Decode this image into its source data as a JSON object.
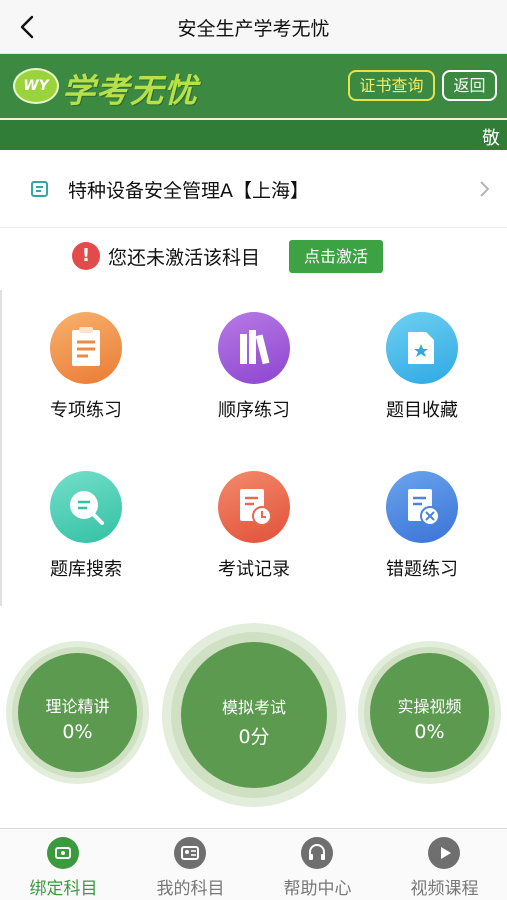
{
  "nav": {
    "title": "安全生产学考无忧"
  },
  "brand": {
    "logo_badge": "WY",
    "logo_text": "学考无忧",
    "cert_button": "证书查询",
    "back_button": "返回",
    "ticker_text": "敬",
    "color": "#3c8a41"
  },
  "subject": {
    "name": "特种设备安全管理A【上海】"
  },
  "notice": {
    "icon": "!",
    "text": "您还未激活该科目",
    "activate_button": "点击激活"
  },
  "features": [
    {
      "label": "专项练习",
      "icon": "clipboard-icon"
    },
    {
      "label": "顺序练习",
      "icon": "books-icon"
    },
    {
      "label": "题目收藏",
      "icon": "star-folder-icon"
    },
    {
      "label": "题库搜索",
      "icon": "search-bubble-icon"
    },
    {
      "label": "考试记录",
      "icon": "clock-doc-icon"
    },
    {
      "label": "错题练习",
      "icon": "error-doc-icon"
    }
  ],
  "progress": [
    {
      "title": "理论精讲",
      "value": "0%"
    },
    {
      "title": "模拟考试",
      "value": "0分"
    },
    {
      "title": "实操视频",
      "value": "0%"
    }
  ],
  "tabs": [
    {
      "label": "绑定科目",
      "icon": "bind-icon",
      "active": true
    },
    {
      "label": "我的科目",
      "icon": "profile-card-icon",
      "active": false
    },
    {
      "label": "帮助中心",
      "icon": "help-headset-icon",
      "active": false
    },
    {
      "label": "视频课程",
      "icon": "play-icon",
      "active": false
    }
  ]
}
